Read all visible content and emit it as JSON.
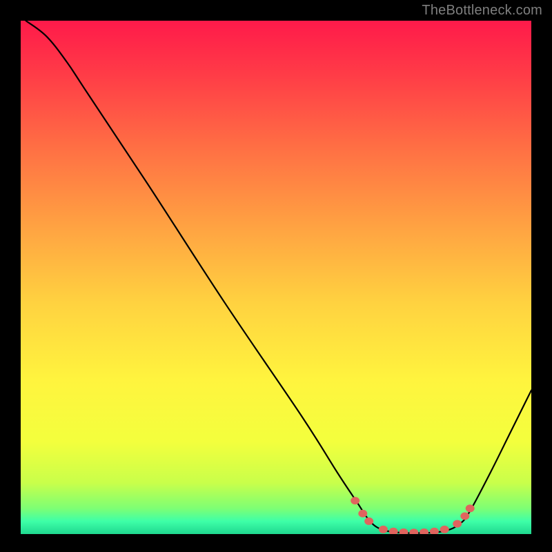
{
  "attribution": "TheBottleneck.com",
  "chart_data": {
    "type": "line",
    "title": "",
    "xlabel": "",
    "ylabel": "",
    "xlim": [
      0,
      100
    ],
    "ylim": [
      0,
      100
    ],
    "background_gradient": [
      {
        "t": 0.0,
        "color": "#ff1a4a"
      },
      {
        "t": 0.1,
        "color": "#ff3a47"
      },
      {
        "t": 0.25,
        "color": "#ff7044"
      },
      {
        "t": 0.4,
        "color": "#ffa242"
      },
      {
        "t": 0.55,
        "color": "#ffd240"
      },
      {
        "t": 0.7,
        "color": "#fff43e"
      },
      {
        "t": 0.82,
        "color": "#f3ff3d"
      },
      {
        "t": 0.9,
        "color": "#c9ff4a"
      },
      {
        "t": 0.95,
        "color": "#7dff74"
      },
      {
        "t": 0.975,
        "color": "#3effa8"
      },
      {
        "t": 1.0,
        "color": "#1fd98f"
      }
    ],
    "curve": [
      {
        "x": 1,
        "y": 100
      },
      {
        "x": 5,
        "y": 97
      },
      {
        "x": 9,
        "y": 92
      },
      {
        "x": 13,
        "y": 86
      },
      {
        "x": 25,
        "y": 68
      },
      {
        "x": 40,
        "y": 45
      },
      {
        "x": 55,
        "y": 23
      },
      {
        "x": 62,
        "y": 12
      },
      {
        "x": 66,
        "y": 6
      },
      {
        "x": 68,
        "y": 3
      },
      {
        "x": 70,
        "y": 1.2
      },
      {
        "x": 73,
        "y": 0.4
      },
      {
        "x": 78,
        "y": 0.2
      },
      {
        "x": 83,
        "y": 0.6
      },
      {
        "x": 86,
        "y": 2
      },
      {
        "x": 88,
        "y": 4.5
      },
      {
        "x": 92,
        "y": 12
      },
      {
        "x": 96,
        "y": 20
      },
      {
        "x": 100,
        "y": 28
      }
    ],
    "markers": [
      {
        "x": 65.5,
        "y": 6.5
      },
      {
        "x": 67.0,
        "y": 4.0
      },
      {
        "x": 68.2,
        "y": 2.5
      },
      {
        "x": 71.0,
        "y": 0.9
      },
      {
        "x": 73.0,
        "y": 0.5
      },
      {
        "x": 75.0,
        "y": 0.35
      },
      {
        "x": 77.0,
        "y": 0.3
      },
      {
        "x": 79.0,
        "y": 0.35
      },
      {
        "x": 81.0,
        "y": 0.5
      },
      {
        "x": 83.0,
        "y": 0.9
      },
      {
        "x": 85.5,
        "y": 2.0
      },
      {
        "x": 87.0,
        "y": 3.5
      },
      {
        "x": 88.0,
        "y": 5.0
      }
    ],
    "marker_color": "#e0645e",
    "curve_color": "#000000"
  }
}
